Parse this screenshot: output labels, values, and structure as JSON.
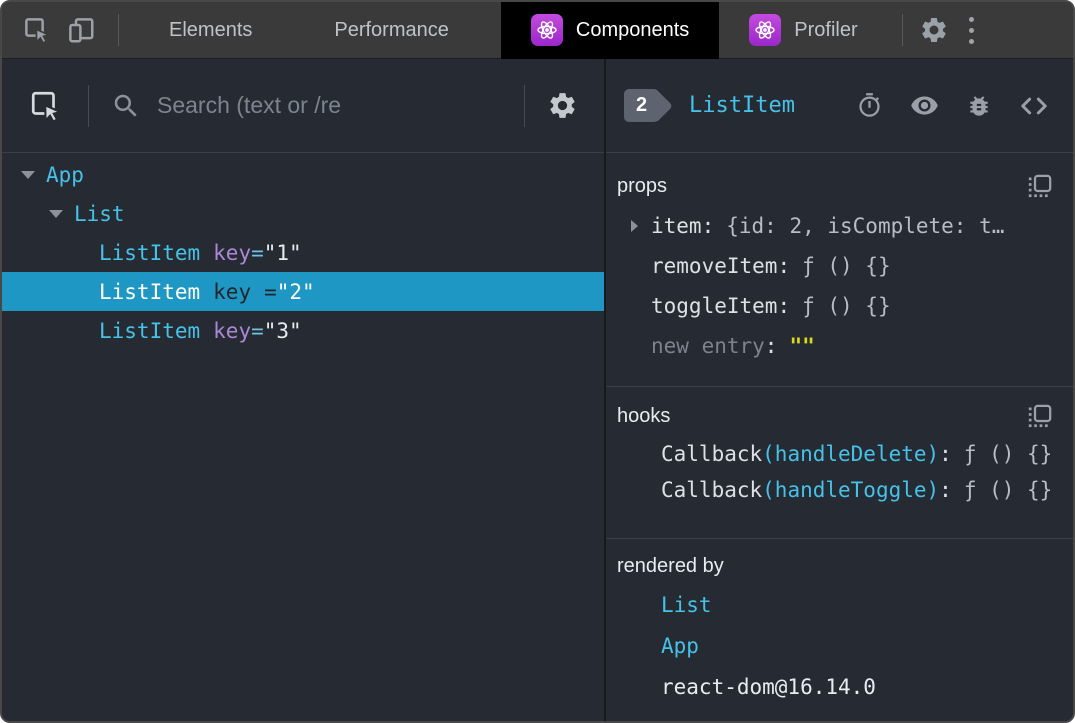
{
  "ui": {
    "colon": ":",
    "eq": "="
  },
  "topbar": {
    "tabs": [
      {
        "label": "Elements",
        "selected": false
      },
      {
        "label": "Performance",
        "selected": false
      },
      {
        "label": "Components",
        "selected": true,
        "icon": "react"
      },
      {
        "label": "Profiler",
        "selected": false,
        "icon": "react"
      }
    ],
    "icons": [
      "inspect-element",
      "toggle-device-toolbar",
      "settings-gear",
      "more-menu"
    ]
  },
  "left": {
    "toolbar": {
      "search_placeholder": "Search (text or /re",
      "icons": [
        "inspect-component",
        "search",
        "settings-gear"
      ]
    },
    "tree": [
      {
        "depth": 0,
        "name": "App",
        "expanded": true,
        "selected": false
      },
      {
        "depth": 1,
        "name": "List",
        "expanded": true,
        "selected": false
      },
      {
        "depth": 2,
        "name": "ListItem",
        "key_attr": "key",
        "key_value": "\"1\"",
        "selected": false
      },
      {
        "depth": 2,
        "name": "ListItem",
        "key_attr": "key",
        "key_value": "\"2\"",
        "selected": true
      },
      {
        "depth": 2,
        "name": "ListItem",
        "key_attr": "key",
        "key_value": "\"3\"",
        "selected": false
      }
    ]
  },
  "right": {
    "header": {
      "badge": "2",
      "title": "ListItem",
      "icons": [
        "suspense-timer",
        "inspect-dom-eye",
        "debug-bug",
        "view-source-code"
      ]
    },
    "props": {
      "title": "props",
      "rows": [
        {
          "name": "item",
          "value": "{id: 2, isComplete: t…",
          "expandable": true
        },
        {
          "name": "removeItem",
          "value": "ƒ () {}"
        },
        {
          "name": "toggleItem",
          "value": "ƒ () {}"
        },
        {
          "name": "new entry",
          "value": "\"\"",
          "muted": true,
          "value_style": "yellow"
        }
      ]
    },
    "hooks": {
      "title": "hooks",
      "rows": [
        {
          "fn": "Callback",
          "arg": "(handleDelete)",
          "value": "ƒ () {}"
        },
        {
          "fn": "Callback",
          "arg": "(handleToggle)",
          "value": "ƒ () {}"
        }
      ]
    },
    "rendered_by": {
      "title": "rendered by",
      "links": [
        "List",
        "App"
      ],
      "static": "react-dom@16.14.0"
    }
  },
  "colors": {
    "component_cyan": "#46c1e7",
    "key_purple": "#ac87d6",
    "selection_blue": "#1f97c5",
    "empty_string_yellow": "#dcdc12",
    "panel_background": "#262b33",
    "topbar_background": "#3a3a3b",
    "selected_tab_background": "#000000",
    "react_icon_purple": "#b13bd2",
    "section_border": "#3a4047"
  }
}
